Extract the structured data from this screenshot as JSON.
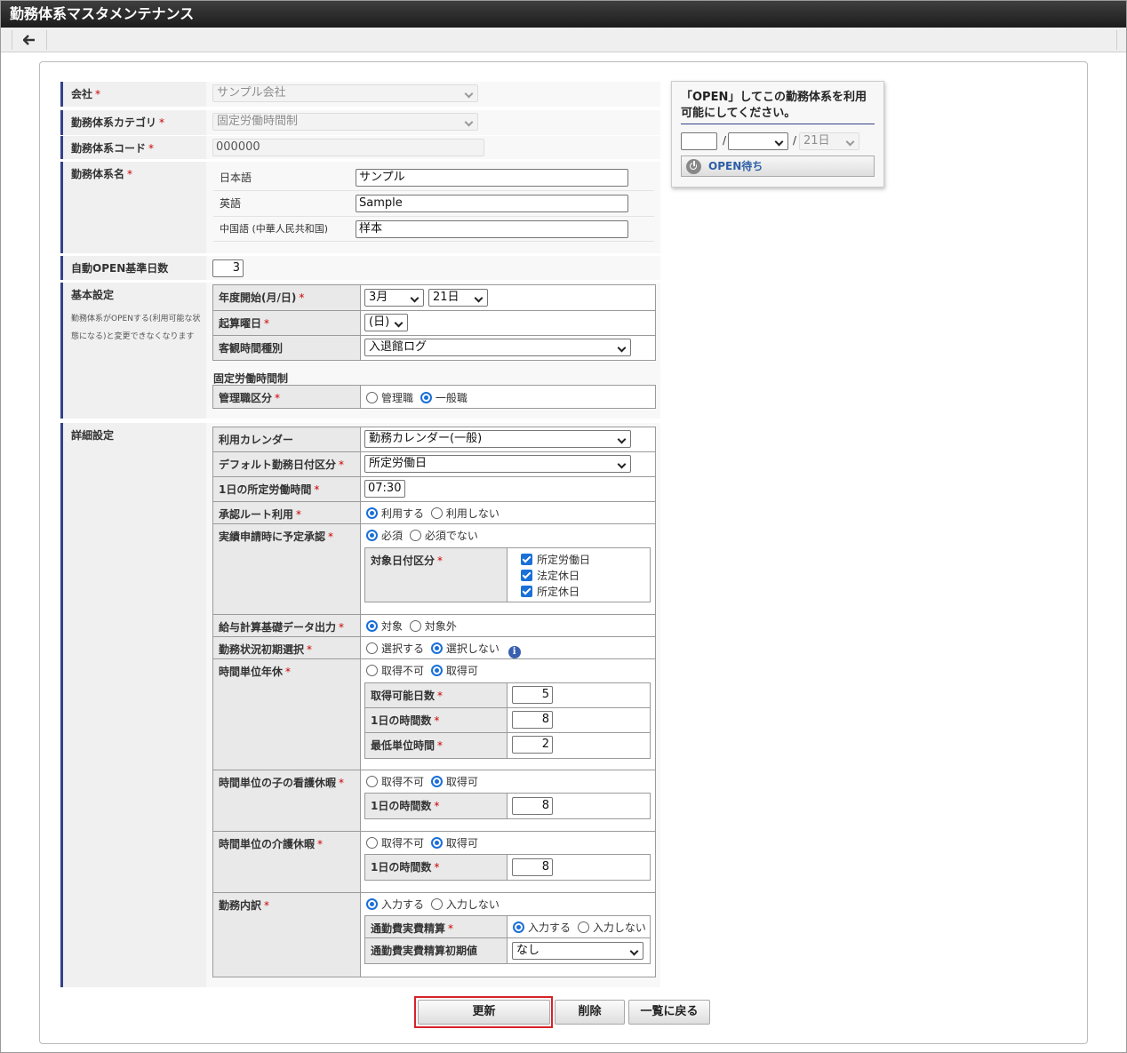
{
  "window": {
    "title": "勤務体系マスタメンテナンス"
  },
  "toolbar": {
    "back_icon": "arrow-left-icon"
  },
  "form": {
    "company": {
      "label": "会社",
      "req": "*",
      "value": "サンプル会社"
    },
    "category": {
      "label": "勤務体系カテゴリ",
      "req": "*",
      "value": "固定労働時間制"
    },
    "code": {
      "label": "勤務体系コード",
      "req": "*",
      "value": "000000"
    },
    "name": {
      "label": "勤務体系名",
      "req": "*",
      "langs": [
        {
          "label": "日本語",
          "value": "サンプル"
        },
        {
          "label": "英語",
          "value": "Sample"
        },
        {
          "label": "中国語 (中華人民共和国)",
          "value": "样本"
        }
      ]
    },
    "auto_open": {
      "label": "自動OPEN基準日数",
      "value": "3"
    },
    "basic": {
      "label": "基本設定",
      "note": "勤務体系がOPENする(利用可能な状態になる)と変更できなくなります",
      "fiscal_start": {
        "label": "年度開始(月/日)",
        "req": "*",
        "month": "3月",
        "day": "21日"
      },
      "start_weekday": {
        "label": "起算曜日",
        "req": "*",
        "value": "(日)"
      },
      "objective_time": {
        "label": "客観時間種別",
        "value": "入退館ログ"
      },
      "fixed_heading": "固定労働時間制",
      "manager_class": {
        "label": "管理職区分",
        "req": "*",
        "options": [
          "管理職",
          "一般職"
        ],
        "selected": 1
      }
    },
    "detail": {
      "label": "詳細設定",
      "calendar": {
        "label": "利用カレンダー",
        "value": "勤務カレンダー(一般)"
      },
      "default_day_type": {
        "label": "デフォルト勤務日付区分",
        "req": "*",
        "value": "所定労働日"
      },
      "daily_hours": {
        "label": "1日の所定労働時間",
        "req": "*",
        "value": "07:30"
      },
      "approval_route": {
        "label": "承認ルート利用",
        "req": "*",
        "options": [
          "利用する",
          "利用しない"
        ],
        "selected": 0
      },
      "pre_approval": {
        "label": "実績申請時に予定承認",
        "req": "*",
        "options": [
          "必須",
          "必須でない"
        ],
        "selected": 0,
        "target_label": "対象日付区分",
        "target_req": "*",
        "targets": [
          "所定労働日",
          "法定休日",
          "所定休日"
        ]
      },
      "payroll_output": {
        "label": "給与計算基礎データ出力",
        "req": "*",
        "options": [
          "対象",
          "対象外"
        ],
        "selected": 0
      },
      "status_initial": {
        "label": "勤務状況初期選択",
        "req": "*",
        "options": [
          "選択する",
          "選択しない"
        ],
        "selected": 1,
        "info_icon": "info-icon"
      },
      "hourly_leave": {
        "label": "時間単位年休",
        "req": "*",
        "options": [
          "取得不可",
          "取得可"
        ],
        "selected": 1,
        "rows": [
          {
            "label": "取得可能日数",
            "req": "*",
            "value": "5"
          },
          {
            "label": "1日の時間数",
            "req": "*",
            "value": "8"
          },
          {
            "label": "最低単位時間",
            "req": "*",
            "value": "2"
          }
        ]
      },
      "child_care": {
        "label": "時間単位の子の看護休暇",
        "req": "*",
        "options": [
          "取得不可",
          "取得可"
        ],
        "selected": 1,
        "row": {
          "label": "1日の時間数",
          "req": "*",
          "value": "8"
        }
      },
      "nursing_care": {
        "label": "時間単位の介護休暇",
        "req": "*",
        "options": [
          "取得不可",
          "取得可"
        ],
        "selected": 1,
        "row": {
          "label": "1日の時間数",
          "req": "*",
          "value": "8"
        }
      },
      "breakdown": {
        "label": "勤務内訳",
        "req": "*",
        "options": [
          "入力する",
          "入力しない"
        ],
        "selected": 0,
        "commute": {
          "label": "通勤費実費精算",
          "req": "*",
          "options": [
            "入力する",
            "入力しない"
          ],
          "selected": 0
        },
        "commute_initial": {
          "label": "通勤費実費精算初期値",
          "value": "なし"
        }
      }
    },
    "buttons": {
      "update": "更新",
      "delete": "削除",
      "back_to_list": "一覧に戻る"
    }
  },
  "open_panel": {
    "message": "「OPEN」してこの勤務体系を利用可能にしてください。",
    "sep": "/",
    "day_value": "21日",
    "button": "OPEN待ち",
    "button_icon": "power-icon"
  },
  "colors": {
    "accent": "#33428a",
    "highlight": "#d6232a",
    "radio": "#1a6fd8"
  }
}
